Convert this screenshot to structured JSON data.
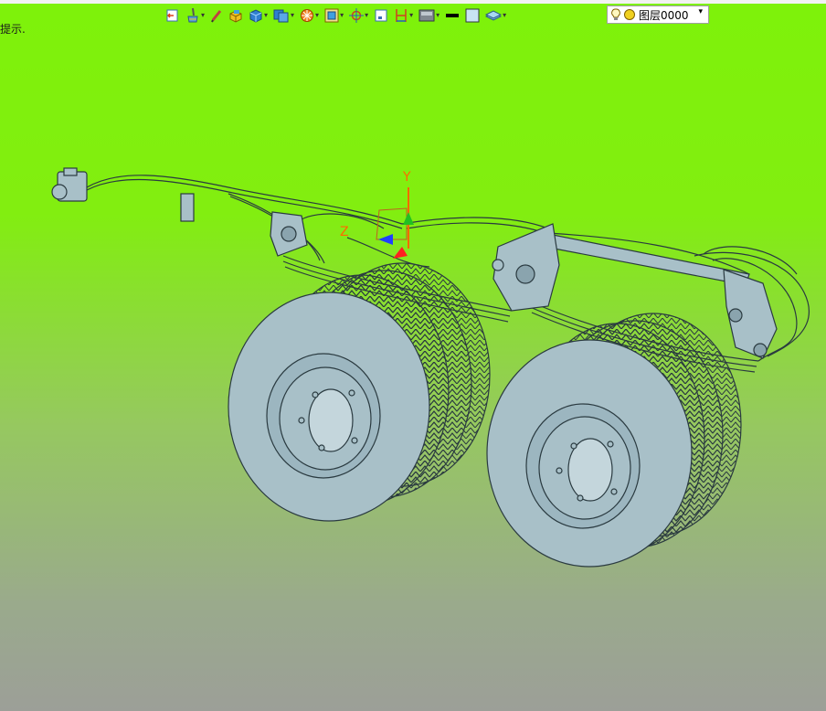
{
  "hint_text": "提示.",
  "toolbar": {
    "items": [
      {
        "icon": "exit-icon"
      },
      {
        "icon": "paint-brush-icon",
        "dropdown": true
      },
      {
        "icon": "pen-icon"
      },
      {
        "icon": "box-3d-icon"
      },
      {
        "icon": "cube-view-icon",
        "dropdown": true
      },
      {
        "icon": "stacked-views-icon",
        "dropdown": true
      },
      {
        "icon": "render-wheel-icon",
        "dropdown": true
      },
      {
        "icon": "image-frame-icon",
        "dropdown": true
      },
      {
        "icon": "snap-target-icon",
        "dropdown": true
      },
      {
        "icon": "work-plane-icon"
      },
      {
        "icon": "dimension-icon",
        "dropdown": true
      },
      {
        "icon": "shading-icon",
        "dropdown": true
      },
      {
        "icon": "line-weight-icon"
      },
      {
        "icon": "color-swatch-icon"
      },
      {
        "icon": "layer-stack-icon",
        "dropdown": true
      }
    ]
  },
  "layer_select": {
    "value": "图层0000",
    "icons": [
      "lightbulb-icon",
      "yellow-circle-icon"
    ]
  },
  "triad": {
    "y_label": "Y",
    "z_label": "Z"
  },
  "colors": {
    "background_top": "#7ef20a",
    "background_bottom": "#9c9f98",
    "model_fill": "#a8c0c8",
    "model_stroke": "#2a3a40",
    "axis_y": "#ff6a00",
    "axis_green": "#22c022",
    "axis_blue": "#2040ff",
    "axis_red": "#ff2020"
  }
}
